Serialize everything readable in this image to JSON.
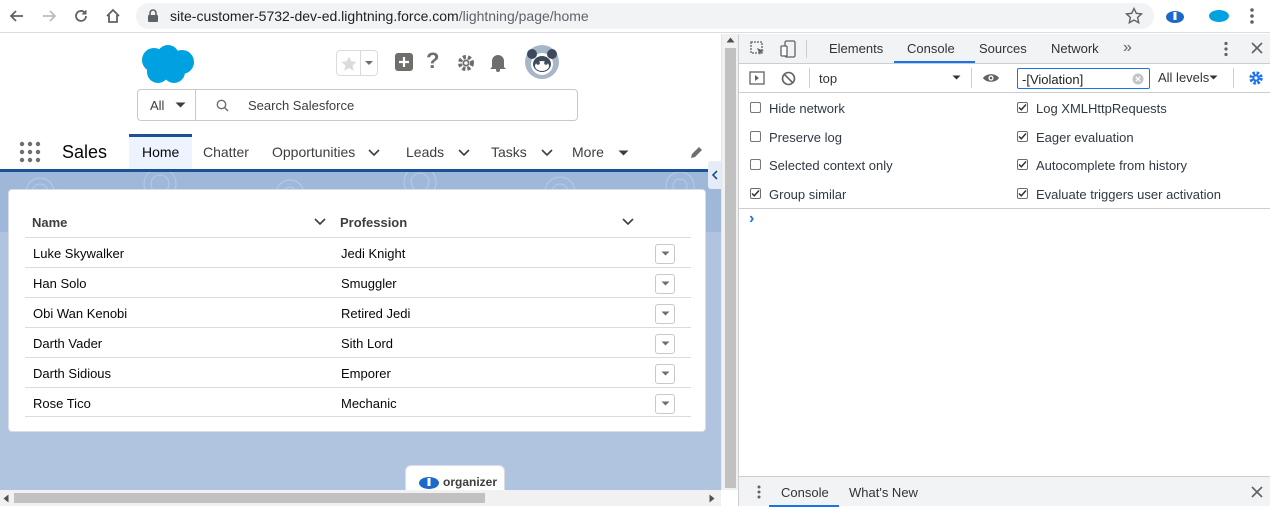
{
  "browser": {
    "url_host": "site-customer-5732-dev-ed.lightning.force.com",
    "url_path": "/lightning/page/home"
  },
  "salesforce": {
    "search": {
      "scope": "All",
      "placeholder": "Search Salesforce"
    },
    "app_name": "Sales",
    "nav_tabs": [
      {
        "label": "Home"
      },
      {
        "label": "Chatter"
      },
      {
        "label": "Opportunities"
      },
      {
        "label": "Leads"
      },
      {
        "label": "Tasks"
      },
      {
        "label": "More"
      }
    ],
    "table": {
      "columns": [
        "Name",
        "Profession"
      ],
      "rows": [
        {
          "name": "Luke Skywalker",
          "profession": "Jedi Knight"
        },
        {
          "name": "Han Solo",
          "profession": "Smuggler"
        },
        {
          "name": "Obi Wan Kenobi",
          "profession": "Retired Jedi"
        },
        {
          "name": "Darth Vader",
          "profession": "Sith Lord"
        },
        {
          "name": "Darth Sidious",
          "profession": "Emporer"
        },
        {
          "name": "Rose Tico",
          "profession": "Mechanic"
        }
      ]
    },
    "organizer_label": "organizer",
    "colors": {
      "brand": "#1b5297",
      "cloud": "#00a1e0"
    }
  },
  "devtools": {
    "tabs": [
      "Elements",
      "Console",
      "Sources",
      "Network"
    ],
    "active_tab": "Console",
    "context": "top",
    "filter": "-[Violation]",
    "levels": "All levels",
    "options_left": [
      {
        "label": "Hide network",
        "checked": false
      },
      {
        "label": "Preserve log",
        "checked": false
      },
      {
        "label": "Selected context only",
        "checked": false
      },
      {
        "label": "Group similar",
        "checked": true
      }
    ],
    "options_right": [
      {
        "label": "Log XMLHttpRequests",
        "checked": true
      },
      {
        "label": "Eager evaluation",
        "checked": true
      },
      {
        "label": "Autocomplete from history",
        "checked": true
      },
      {
        "label": "Evaluate triggers user activation",
        "checked": true
      }
    ],
    "prompt": "›",
    "drawer_tabs": [
      "Console",
      "What's New"
    ]
  }
}
